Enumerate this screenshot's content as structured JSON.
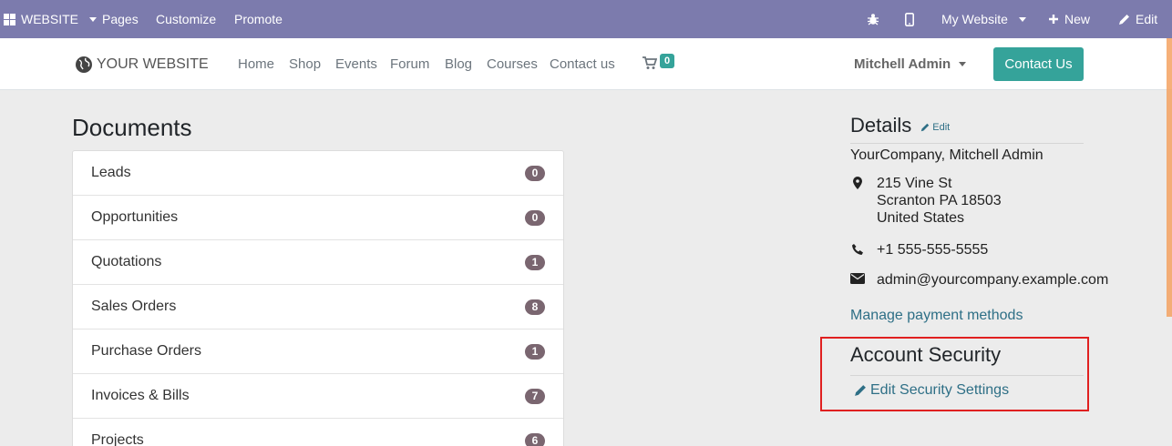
{
  "adminbar": {
    "website": "WEBSITE",
    "pages": "Pages",
    "customize": "Customize",
    "promote": "Promote",
    "my_website": "My Website",
    "new": "New",
    "edit": "Edit",
    "color": "#7c7bad"
  },
  "header": {
    "logo": "YOUR WEBSITE",
    "nav": [
      "Home",
      "Shop",
      "Events",
      "Forum",
      "Blog",
      "Courses",
      "Contact us"
    ],
    "cart_count": "0",
    "user": "Mitchell Admin",
    "contact_button": "Contact Us",
    "accent": "#35a39a"
  },
  "documents": {
    "title": "Documents",
    "rows": [
      {
        "label": "Leads",
        "count": "0"
      },
      {
        "label": "Opportunities",
        "count": "0"
      },
      {
        "label": "Quotations",
        "count": "1"
      },
      {
        "label": "Sales Orders",
        "count": "8"
      },
      {
        "label": "Purchase Orders",
        "count": "1"
      },
      {
        "label": "Invoices & Bills",
        "count": "7"
      },
      {
        "label": "Projects",
        "count": "6"
      }
    ]
  },
  "details": {
    "title": "Details",
    "edit": "Edit",
    "company": "YourCompany, Mitchell Admin",
    "address": [
      "215 Vine St",
      "Scranton PA 18503",
      "United States"
    ],
    "phone": "+1 555-555-5555",
    "email": "admin@yourcompany.example.com",
    "payment_link": "Manage payment methods"
  },
  "security": {
    "title": "Account Security",
    "link": "Edit Security Settings"
  },
  "icons": {
    "apps": "apps-grid-icon",
    "bug": "bug-icon",
    "mobile": "mobile-icon",
    "plus": "plus-icon",
    "pencil": "pencil-icon",
    "globe": "globe-icon",
    "cart": "cart-icon",
    "map_marker": "map-marker-icon",
    "phone": "phone-icon",
    "envelope": "envelope-icon"
  }
}
